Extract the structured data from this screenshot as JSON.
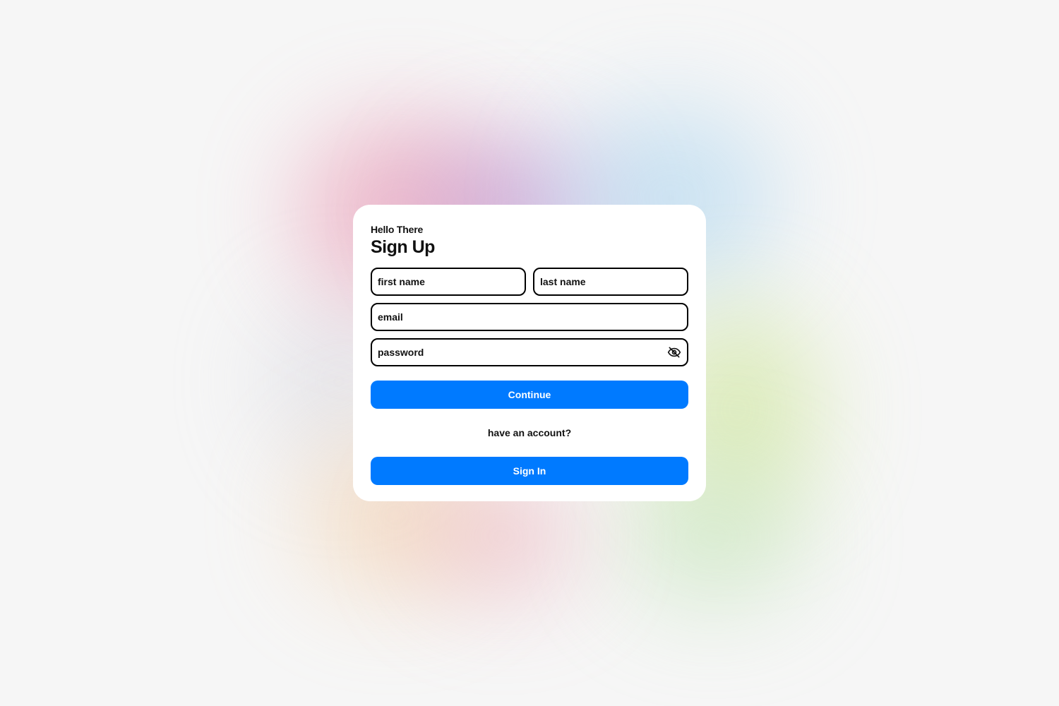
{
  "form": {
    "greeting": "Hello There",
    "title": "Sign Up",
    "first_name_placeholder": "first name",
    "last_name_placeholder": "last name",
    "email_placeholder": "email",
    "password_placeholder": "password",
    "password_toggle_icon": "eye-slash-icon",
    "continue_label": "Continue",
    "have_account_text": "have an account?",
    "sign_in_label": "Sign In"
  },
  "colors": {
    "accent": "#007aff",
    "card_background": "#ffffff",
    "page_background": "#f6f6f6",
    "field_border": "#000000"
  }
}
